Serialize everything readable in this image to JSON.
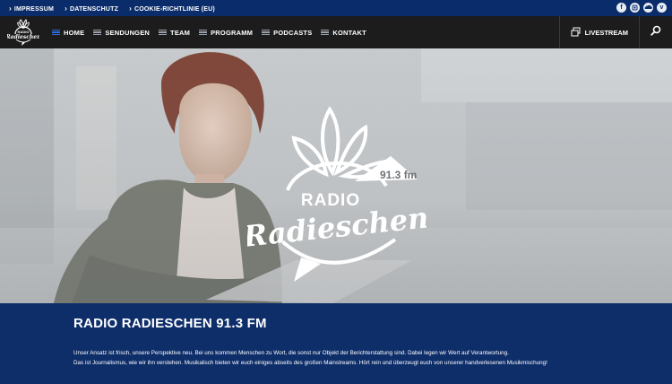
{
  "topbar": {
    "links": [
      "IMPRESSUM",
      "DATENSCHUTZ",
      "COOKIE-RICHTLINIE (EU)"
    ],
    "social_icons": [
      "facebook-icon",
      "instagram-icon",
      "soundcloud-icon",
      "vimeo-icon"
    ]
  },
  "nav": {
    "items": [
      {
        "label": "HOME",
        "active": true
      },
      {
        "label": "SENDUNGEN"
      },
      {
        "label": "TEAM"
      },
      {
        "label": "PROGRAMM"
      },
      {
        "label": "PODCASTS"
      },
      {
        "label": "KONTAKT"
      }
    ],
    "livestream_label": "LIVESTREAM"
  },
  "brand": {
    "line1": "RADIO",
    "line2": "Radieschen",
    "frequency": "91.3 fm"
  },
  "info": {
    "title": "RADIO RADIESCHEN 91.3 FM",
    "paragraph1": "Unser Ansatz ist frisch, unsere Perspektive neu. Bei uns kommen Menschen zu Wort, die sonst nur Objekt der Berichterstattung sind. Dabei legen wir Wert auf Verantwortung.",
    "paragraph2": "Das ist Journalismus, wie wir ihn verstehen. Musikalisch bieten wir euch einiges abseits des großen Mainstreams. Hört rein und überzeugt euch von unserer handverlesenen Musikmischung!"
  },
  "colors": {
    "topbar": "#0b2c6a",
    "nav": "#1c1c1c",
    "accent": "#2d6ad6",
    "info": "#0e2e6a"
  }
}
